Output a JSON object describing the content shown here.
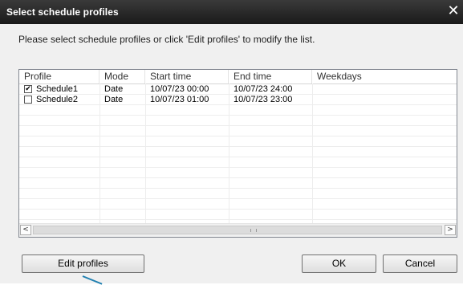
{
  "window": {
    "title": "Select schedule profiles",
    "close_icon": "close-icon",
    "close_glyph": "✕"
  },
  "instruction": "Please select schedule profiles or click 'Edit profiles' to modify the list.",
  "table": {
    "columns": [
      "Profile",
      "Mode",
      "Start time",
      "End time",
      "Weekdays"
    ],
    "rows": [
      {
        "checked": true,
        "check_glyph": "✔",
        "profile": "Schedule1",
        "mode": "Date",
        "start": "10/07/23 00:00",
        "end": "10/07/23 24:00",
        "weekdays": ""
      },
      {
        "checked": false,
        "check_glyph": "",
        "profile": "Schedule2",
        "mode": "Date",
        "start": "10/07/23 01:00",
        "end": "10/07/23 23:00",
        "weekdays": ""
      }
    ]
  },
  "scrollbar": {
    "left_arrow": "<",
    "right_arrow": ">",
    "left_icon": "scroll-left-icon",
    "right_icon": "scroll-right-icon"
  },
  "buttons": {
    "edit_profiles": "Edit profiles",
    "ok": "OK",
    "cancel": "Cancel"
  }
}
